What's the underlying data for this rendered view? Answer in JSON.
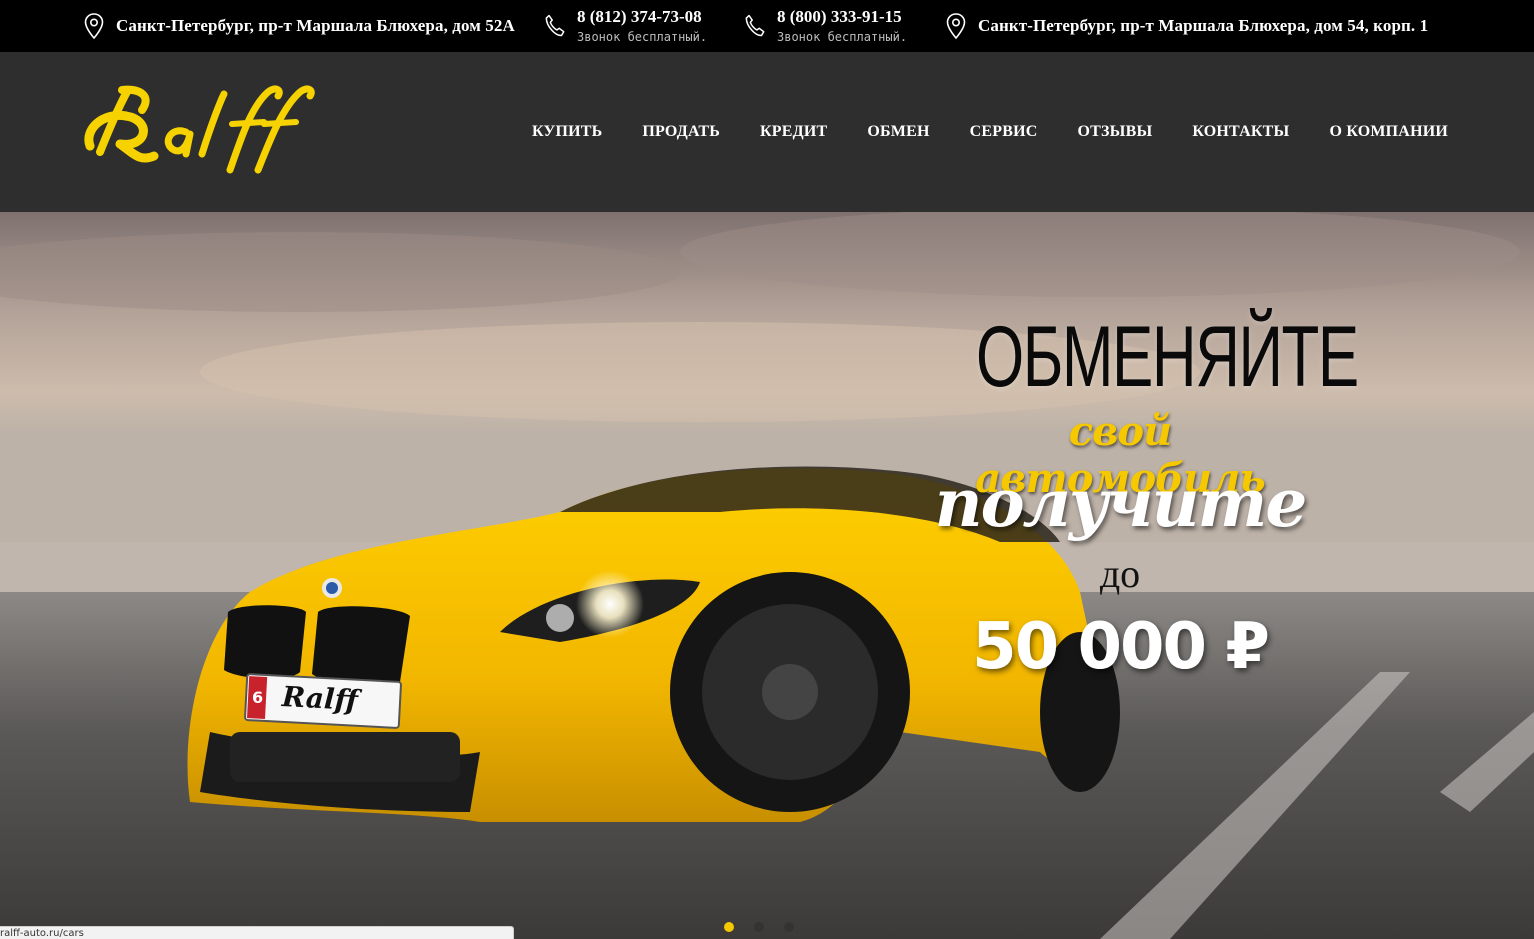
{
  "topbar": {
    "address1": "Санкт-Петербург, пр-т Маршала Блюхера, дом 52А",
    "phone1": "8 (812) 374-73-08",
    "phone1_note": "Звонок бесплатный.",
    "phone2": "8 (800) 333-91-15",
    "phone2_note": "Звонок бесплатный.",
    "address2": "Санкт-Петербург, пр-т Маршала Блюхера, дом 54, корп. 1"
  },
  "header": {
    "logo_text": "Ralff",
    "nav": [
      "КУПИТЬ",
      "ПРОДАТЬ",
      "КРЕДИТ",
      "ОБМЕН",
      "СЕРВИС",
      "ОТЗЫВЫ",
      "КОНТАКТЫ",
      "О КОМПАНИИ"
    ]
  },
  "hero": {
    "line1": "ОБМЕНЯЙТЕ",
    "line2": "свой автомобиль",
    "line3": "получите",
    "line4": "до",
    "line5": "50 000 ₽",
    "plate_text": "Ralff",
    "plate_number": "6",
    "slides_total": 3,
    "slide_active": 1
  },
  "statusbar": {
    "url": "ralff-auto.ru/cars"
  },
  "colors": {
    "accent": "#f6c800",
    "header_bg": "#2e2e2e",
    "topbar_bg": "#000000"
  },
  "icons": [
    "map-pin-icon",
    "phone-icon"
  ]
}
